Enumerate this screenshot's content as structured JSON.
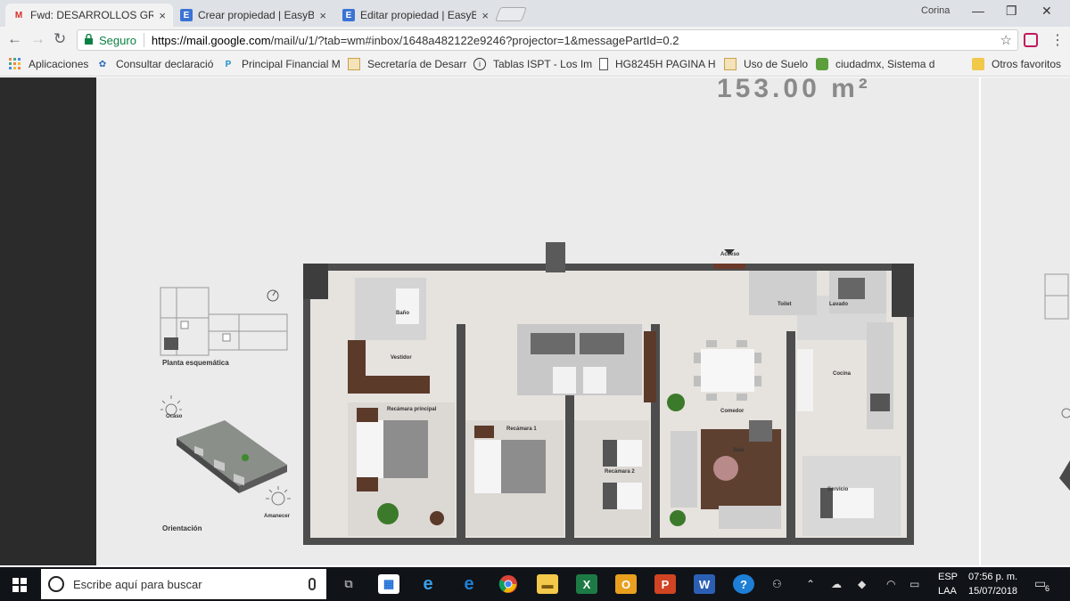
{
  "browser": {
    "tabs": [
      {
        "title": "Fwd: DESARROLLOS GRU",
        "favicon": "gmail-icon",
        "close": "×"
      },
      {
        "title": "Crear propiedad | EasyBr",
        "favicon": "easybroker-icon",
        "close": "×"
      },
      {
        "title": "Editar propiedad | EasyBr",
        "favicon": "easybroker-icon",
        "close": "×"
      }
    ],
    "user_name": "Corina",
    "window_controls": {
      "minimize": "—",
      "restore": "❐",
      "close": "✕"
    },
    "nav": {
      "back": "←",
      "forward": "→",
      "reload": "↻"
    },
    "security_label": "Seguro",
    "url_host": "https://mail.google.com",
    "url_path": "/mail/u/1/?tab=wm#inbox/1648a482122e9246?projector=1&messagePartId=0.2",
    "star": "☆",
    "menu": "⋮"
  },
  "bookmarks": [
    {
      "label": "Aplicaciones",
      "icon": "apps-grid-icon"
    },
    {
      "label": "Consultar declaració",
      "icon": "sat-icon"
    },
    {
      "label": "Principal Financial M",
      "icon": "principal-icon"
    },
    {
      "label": "Secretaría de Desarr",
      "icon": "page-icon"
    },
    {
      "label": "Tablas ISPT - Los Im",
      "icon": "info-icon"
    },
    {
      "label": "HG8245H PAGINA H",
      "icon": "document-icon"
    },
    {
      "label": "Uso de Suelo",
      "icon": "page-icon"
    },
    {
      "label": "ciudadmx, Sistema d",
      "icon": "ciudadmx-icon"
    },
    {
      "label": "Otros favoritos",
      "icon": "folder-icon"
    }
  ],
  "floorplan": {
    "area": "153.00 m²",
    "labels": {
      "schematic": "Planta esquemática",
      "orientation": "Orientación",
      "access": "Acceso",
      "bath": "Baño",
      "master_bedroom": "Recámara principal",
      "bedroom1": "Recámara 1",
      "bedroom2": "Recámara 2",
      "dining": "Comedor",
      "living": "Sala",
      "kitchen": "Cocina",
      "toilet": "Toilet",
      "laundry": "Lavado",
      "service": "Servicio",
      "closet": "Vestidor",
      "west": "Ocaso",
      "east": "Amanecer"
    }
  },
  "taskbar": {
    "search_placeholder": "Escribe aquí para buscar",
    "apps": [
      {
        "name": "task-view-icon",
        "glyph": "⧉"
      },
      {
        "name": "store-icon",
        "glyph": "🛍"
      },
      {
        "name": "internet-explorer-icon",
        "glyph": "e"
      },
      {
        "name": "edge-icon",
        "glyph": "e"
      },
      {
        "name": "chrome-icon",
        "glyph": "●"
      },
      {
        "name": "file-explorer-icon",
        "glyph": "▬"
      },
      {
        "name": "excel-icon",
        "glyph": "X"
      },
      {
        "name": "outlook-icon",
        "glyph": "O"
      },
      {
        "name": "powerpoint-icon",
        "glyph": "P"
      },
      {
        "name": "word-icon",
        "glyph": "W"
      },
      {
        "name": "help-icon",
        "glyph": "?"
      }
    ],
    "language": "ESP",
    "layout": "LAA",
    "time": "07:56 p. m.",
    "date": "15/07/2018",
    "notifications": "6"
  },
  "colors": {
    "tab_bg": "#dee1e6",
    "secure_green": "#0b8043",
    "taskbar": "#101318",
    "plan_wall": "#4a4a4a"
  }
}
